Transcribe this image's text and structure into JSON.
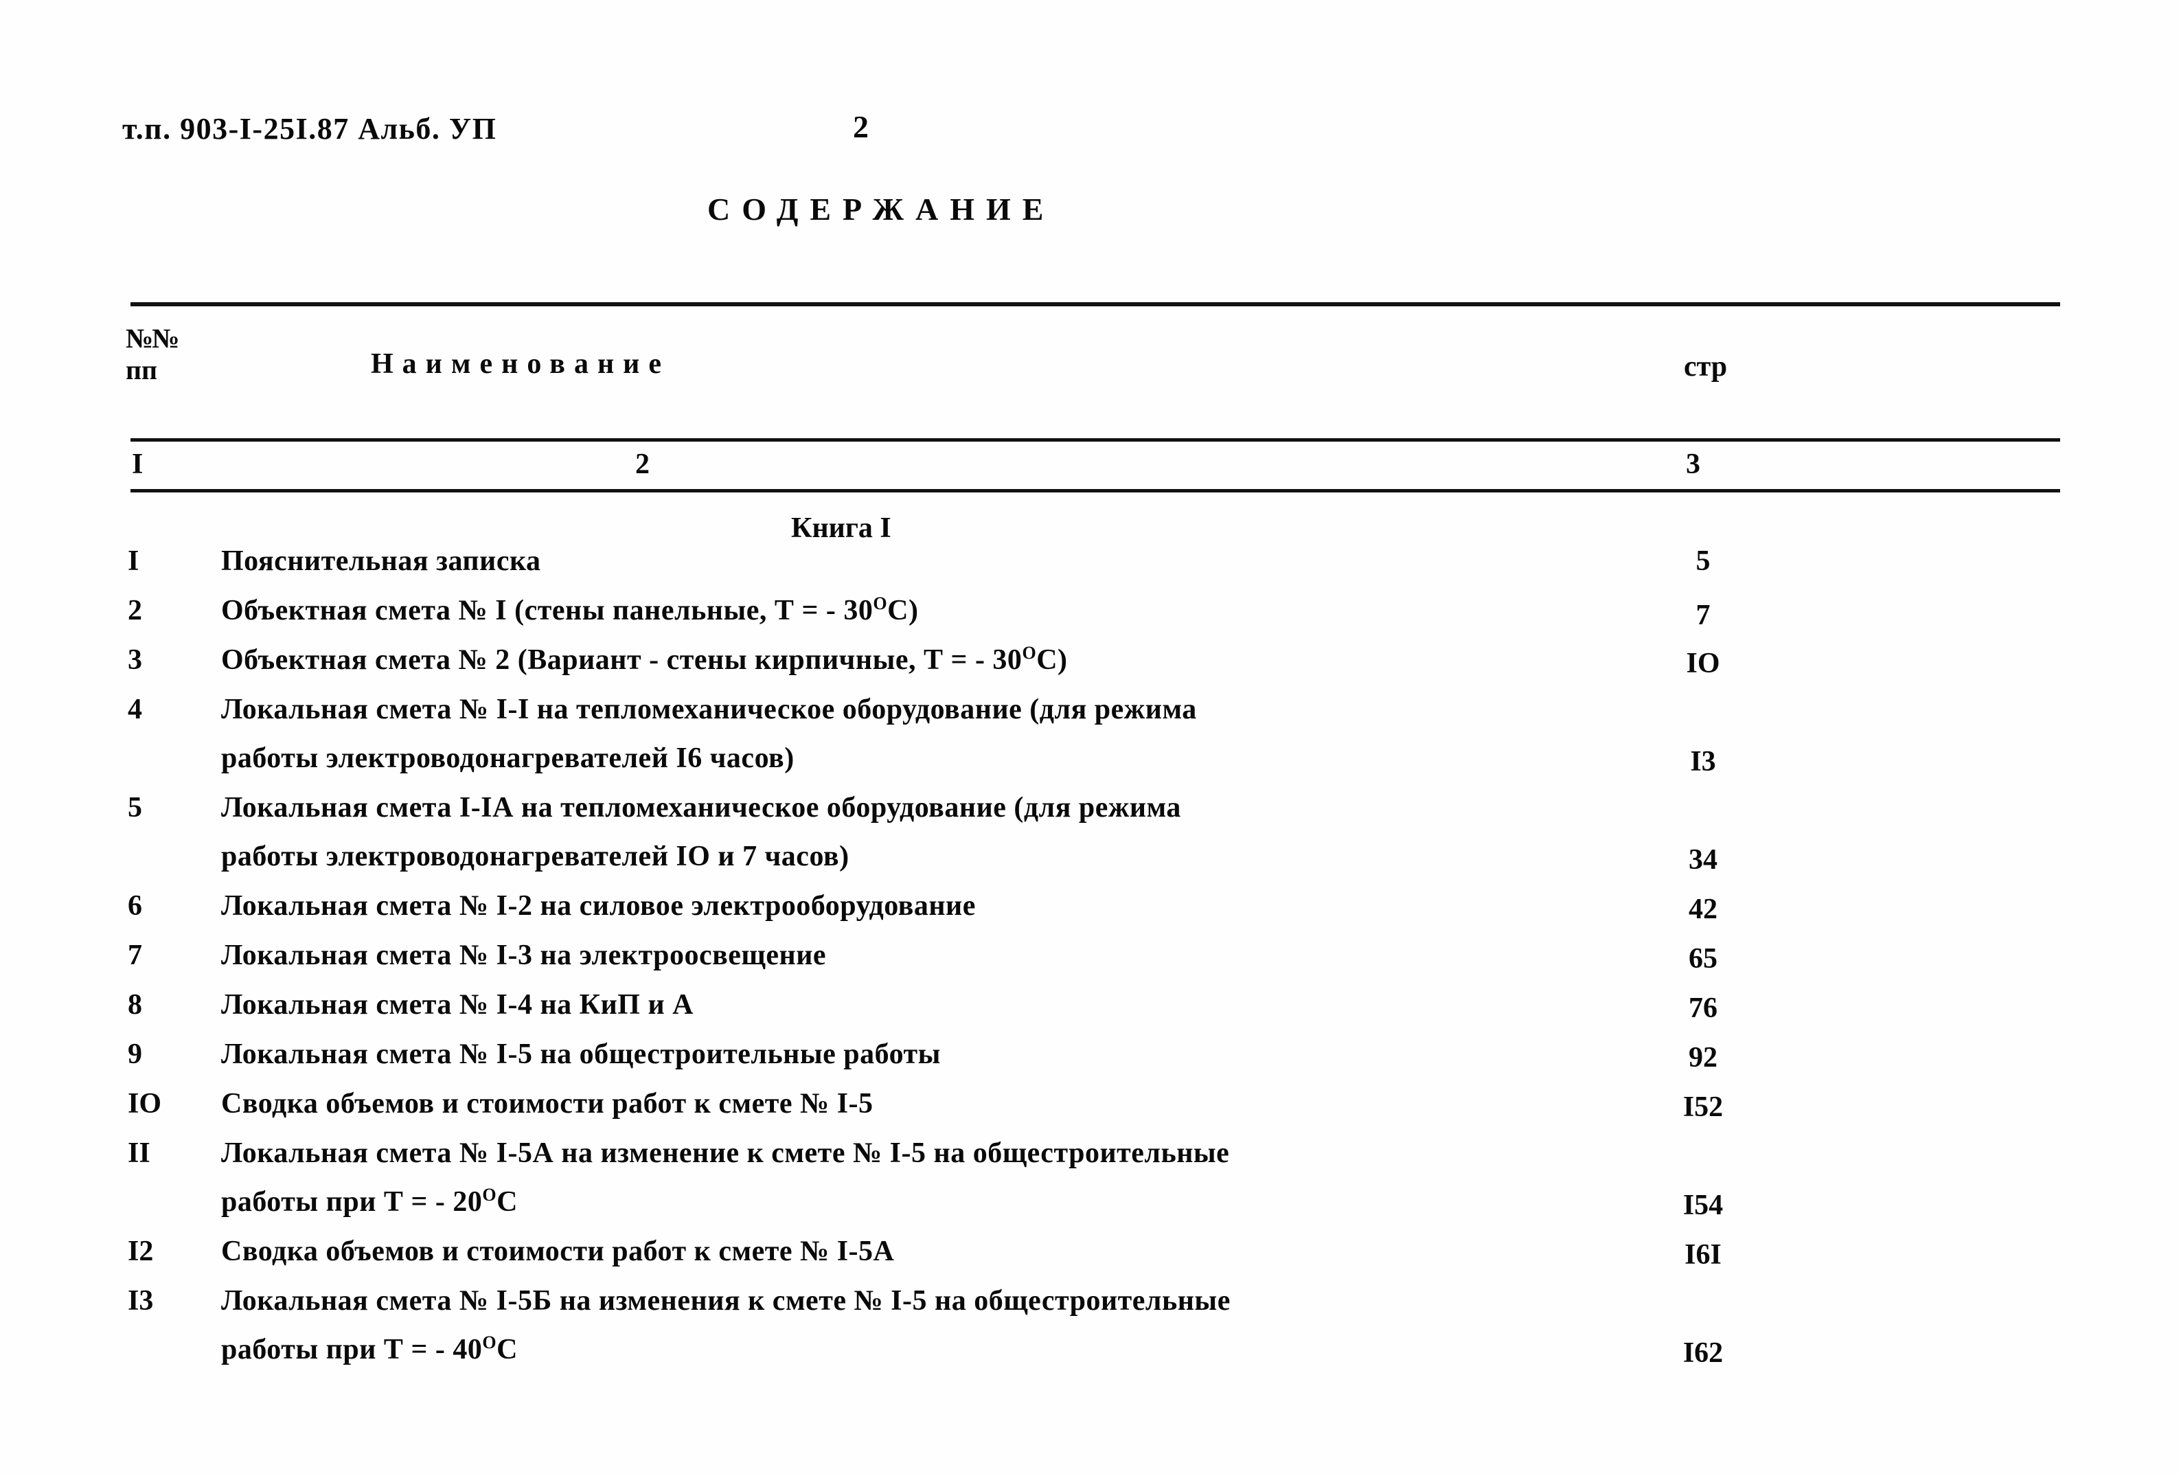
{
  "document": {
    "code_line": "т.п. 903-I-25I.87  Альб. УП",
    "folio": "2",
    "title": "СОДЕРЖАНИЕ"
  },
  "table": {
    "header": {
      "num_line1": "№№",
      "num_line2": "пп",
      "name": "Наименование",
      "page": "стр"
    },
    "column_numbers": {
      "c1": "I",
      "c2": "2",
      "c3": "3"
    },
    "book_heading": "Книга I",
    "rows": [
      {
        "num": "I",
        "line1": "Пояснительная записка",
        "line2": "",
        "page": "5"
      },
      {
        "num": "2",
        "line1": "Объектная смета № I (стены панельные, Т = - 30°С)",
        "line2": "",
        "page": "7"
      },
      {
        "num": "3",
        "line1": "Объектная смета № 2 (Вариант - стены кирпичные, Т = - 30°С)",
        "line2": "",
        "page": "IO"
      },
      {
        "num": "4",
        "line1": "Локальная смета № I-I на тепломеханическое оборудование (для режима",
        "line2": "работы электроводонагревателей I6 часов)",
        "page": "I3"
      },
      {
        "num": "5",
        "line1": "Локальная смета I-IА на тепломеханическое оборудование (для режима",
        "line2": "работы электроводонагревателей IO и 7 часов)",
        "page": "34"
      },
      {
        "num": "6",
        "line1": "Локальная смета № I-2 на силовое электрооборудование",
        "line2": "",
        "page": "42"
      },
      {
        "num": "7",
        "line1": "Локальная смета № I-3 на электроосвещение",
        "line2": "",
        "page": "65"
      },
      {
        "num": "8",
        "line1": "Локальная смета № I-4 на КиП и А",
        "line2": "",
        "page": "76"
      },
      {
        "num": "9",
        "line1": "Локальная смета № I-5 на общестроительные работы",
        "line2": "",
        "page": "92"
      },
      {
        "num": "IO",
        "line1": "Сводка объемов и  стоимости работ к смете № I-5",
        "line2": "",
        "page": "I52"
      },
      {
        "num": "II",
        "line1": "Локальная смета № I-5А на изменение к смете № I-5 на общестроительные",
        "line2": "работы при  Т = - 20°С",
        "page": "I54"
      },
      {
        "num": "I2",
        "line1": "Сводка объемов и стоимости работ к смете № I-5А",
        "line2": "",
        "page": "I6I"
      },
      {
        "num": "I3",
        "line1": "Локальная смета № I-5Б на изменения к смете № I-5 на общестроительные",
        "line2": "работы при Т = - 40°С",
        "page": "I62"
      }
    ]
  }
}
